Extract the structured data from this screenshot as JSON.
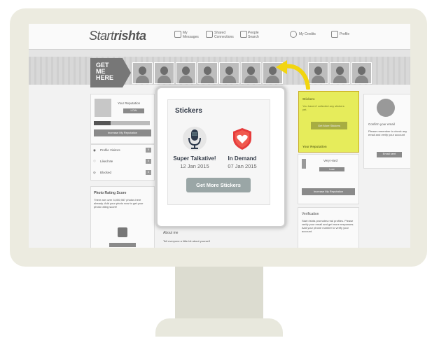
{
  "app": {
    "logo_part1": "Start",
    "logo_part2": "rishta",
    "nav": [
      {
        "label": "My Messages"
      },
      {
        "label": "Shared Connections"
      },
      {
        "label": "People Search"
      },
      {
        "label": "My Credits"
      },
      {
        "label": "Profile"
      }
    ]
  },
  "banner": {
    "line1": "GET",
    "line2": "ME",
    "line3": "HERE"
  },
  "left": {
    "your_reputation": "Your Reputation",
    "level": "LOW",
    "increase": "Increase My Reputation",
    "items": [
      {
        "label": "Profile Visitors",
        "count": "0"
      },
      {
        "label": "Liked Me",
        "count": "0"
      },
      {
        "label": "Blocked",
        "count": "0"
      }
    ],
    "rating_title": "Photo Rating Score",
    "rating_text": "There are over 3,000,987 photos here already. Add your photo now to get your photo rating score!"
  },
  "center": {
    "about": "About me",
    "about_hint": "Tell everyone a little bit about yourself"
  },
  "right": {
    "stickers_title": "Stickers",
    "stickers_text": "You haven't collected any stickers yet.",
    "stickers_btn": "Get More Stickers",
    "reputation_title": "Your Reputation",
    "very_hard": "Very Hard",
    "low": "Low",
    "increase": "Increase My Reputation",
    "verification_title": "Verification",
    "verification_text": "Start rishta promotes real profiles. Please verify your email and get more responses. Add your phone number to verify your account."
  },
  "far_right": {
    "confirm": "Confirm your email",
    "text": "Please remember to check any email and verify your account",
    "btn": "Email sent"
  },
  "modal": {
    "title": "Stickers",
    "stickers": [
      {
        "name": "Super Talkative!",
        "date": "12 Jan 2015",
        "icon": "microphone-icon"
      },
      {
        "name": "In Demand",
        "date": "07 Jan 2015",
        "icon": "heart-shield-icon"
      }
    ],
    "button": "Get More Stickers"
  },
  "colors": {
    "highlight": "#e8ef3a",
    "arrow": "#f2d50f",
    "button": "#9aa6a6",
    "shield_red": "#e63c3c"
  }
}
